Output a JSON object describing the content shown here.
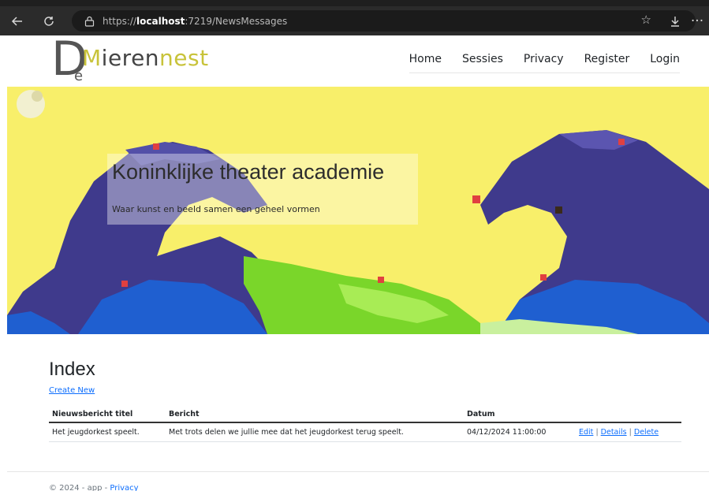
{
  "browser": {
    "url_prefix": "https://",
    "url_host": "localhost",
    "url_rest": ":7219/NewsMessages"
  },
  "logo": {
    "big_letter": "D",
    "small_letter": "e",
    "word_first": "M",
    "word_accent": "ieren",
    "word_end": "nest"
  },
  "nav": {
    "items": [
      "Home",
      "Sessies",
      "Privacy",
      "Register",
      "Login"
    ]
  },
  "hero": {
    "title": "Koninklijke theater academie",
    "subtitle": "Waar kunst en beeld samen een geheel vormen"
  },
  "main": {
    "heading": "Index",
    "create_link": "Create New",
    "table": {
      "headers": [
        "Nieuwsbericht titel",
        "Bericht",
        "Datum",
        ""
      ],
      "rows": [
        {
          "titel": "Het jeugdorkest speelt.",
          "bericht": "Met trots delen we jullie mee dat het jeugdorkest terug speelt.",
          "datum": "04/12/2024 11:00:00",
          "actions": [
            "Edit",
            "Details",
            "Delete"
          ]
        }
      ]
    }
  },
  "footer": {
    "copyright": "© 2024 - ",
    "brand": "app",
    "separator": " - ",
    "privacy": "Privacy"
  },
  "colors": {
    "accent": "#c8c33a",
    "link": "#0d6efd",
    "hero_bg": "#f8ef6a",
    "wave": "#3f3a8c"
  }
}
